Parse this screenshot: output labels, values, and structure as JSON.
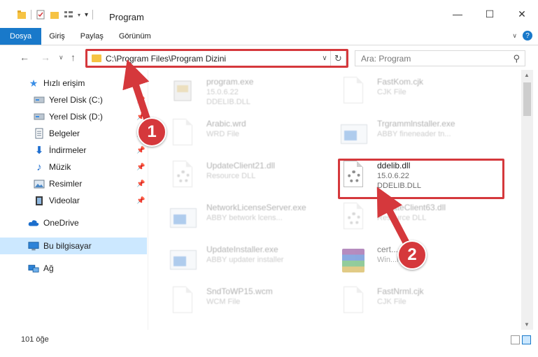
{
  "window": {
    "title": "Program"
  },
  "ribbon": {
    "tabs": [
      "Dosya",
      "Giriş",
      "Paylaş",
      "Görünüm"
    ]
  },
  "address": {
    "path": "C:\\Program Files\\Program Dizini",
    "search_placeholder": "Ara: Program"
  },
  "sidebar": {
    "quick_access": "Hızlı erişim",
    "items": [
      {
        "label": "Yerel Disk (C:)",
        "icon": "drive-icon"
      },
      {
        "label": "Yerel Disk (D:)",
        "icon": "drive-icon"
      },
      {
        "label": "Belgeler",
        "icon": "documents-icon"
      },
      {
        "label": "İndirmeler",
        "icon": "download-icon"
      },
      {
        "label": "Müzik",
        "icon": "music-icon"
      },
      {
        "label": "Resimler",
        "icon": "pictures-icon"
      },
      {
        "label": "Videolar",
        "icon": "video-icon"
      }
    ],
    "onedrive": "OneDrive",
    "this_pc": "Bu bilgisayar",
    "network": "Ağ"
  },
  "files": [
    {
      "name": "program.exe",
      "line2": "15.0.6.22",
      "line3": "DDELIB.DLL",
      "icon": "exe-icon"
    },
    {
      "name": "FastKom.cjk",
      "line2": "CJK File",
      "line3": "",
      "icon": "blank-file-icon"
    },
    {
      "name": "Arabic.wrd",
      "line2": "WRD File",
      "line3": "",
      "icon": "blank-file-icon"
    },
    {
      "name": "Trgrammlnstaller.exe",
      "line2": "ABBY fineneader tn...",
      "line3": "",
      "icon": "app-icon"
    },
    {
      "name": "UpdateClient21.dll",
      "line2": "Resource DLL",
      "line3": "",
      "icon": "dll-icon"
    },
    {
      "name": "ddelib.dll",
      "line2": "15.0.6.22",
      "line3": "DDELIB.DLL",
      "icon": "dll-icon"
    },
    {
      "name": "NetworkLicenseServer.exe",
      "line2": "ABBY betwork lcens...",
      "line3": "",
      "icon": "app-icon"
    },
    {
      "name": "UpdateClient63.dll",
      "line2": "Resource DLL",
      "line3": "",
      "icon": "dll-icon"
    },
    {
      "name": "UpdateInstaller.exe",
      "line2": "ABBY updater installer",
      "line3": "",
      "icon": "app-icon"
    },
    {
      "name": "cert...cab",
      "line2": "Win...hive",
      "line3": "",
      "icon": "archive-icon"
    },
    {
      "name": "SndToWP15.wcm",
      "line2": "WCM File",
      "line3": "",
      "icon": "blank-file-icon"
    },
    {
      "name": "FastNrml.cjk",
      "line2": "CJK File",
      "line3": "",
      "icon": "blank-file-icon"
    }
  ],
  "status": {
    "item_count": "101 öğe"
  },
  "annotations": {
    "step1": "1",
    "step2": "2",
    "color": "#d5383c"
  }
}
